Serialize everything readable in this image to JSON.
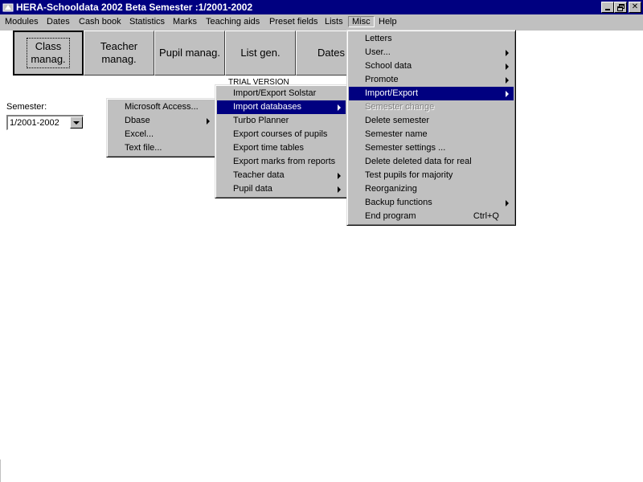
{
  "window": {
    "title": "HERA-Schooldata 2002 Beta Semester :1/2001-2002"
  },
  "menubar": [
    {
      "label": "Modules",
      "underline": "M"
    },
    {
      "label": "Dates",
      "underline": "D"
    },
    {
      "label": "Cash book",
      "underline": "C"
    },
    {
      "label": "Statistics",
      "underline": "S"
    },
    {
      "label": "Marks",
      "underline": "r"
    },
    {
      "label": "Teaching aids",
      "underline": "T"
    },
    {
      "label": "Preset fields",
      "underline": "P"
    },
    {
      "label": "Lists",
      "underline": "L"
    },
    {
      "label": "Misc",
      "underline": "i"
    },
    {
      "label": "Help",
      "underline": "H"
    }
  ],
  "toolbar": [
    {
      "label": "Class\nmanag."
    },
    {
      "label": "Teacher\nmanag."
    },
    {
      "label": "Pupil manag."
    },
    {
      "label": "List gen."
    },
    {
      "label": "Dates"
    }
  ],
  "semester": {
    "label": "Semester:",
    "value": "1/2001-2002"
  },
  "trial_text": "TRIAL VERSION",
  "misc_menu": [
    {
      "label": "Letters",
      "submenu": false
    },
    {
      "label": "User...",
      "submenu": true
    },
    {
      "label": "School data",
      "submenu": true
    },
    {
      "label": "Promote",
      "submenu": true
    },
    {
      "label": "Import/Export",
      "submenu": true,
      "highlighted": true
    },
    {
      "label": "Semester change",
      "disabled": true
    },
    {
      "label": "Delete semester"
    },
    {
      "label": "Semester name"
    },
    {
      "label": "Semester settings ..."
    },
    {
      "label": "Delete deleted data for real"
    },
    {
      "label": "Test pupils for majority"
    },
    {
      "label": "Reorganizing"
    },
    {
      "label": "Backup functions",
      "submenu": true
    },
    {
      "label": "End program",
      "shortcut": "Ctrl+Q"
    }
  ],
  "import_export_menu": [
    {
      "label": "Import/Export Solstar"
    },
    {
      "label": "Import databases",
      "submenu": true,
      "highlighted": true
    },
    {
      "label": "Turbo Planner"
    },
    {
      "label": "Export courses of pupils"
    },
    {
      "label": "Export time tables"
    },
    {
      "label": "Export marks from reports"
    },
    {
      "label": "Teacher data",
      "submenu": true
    },
    {
      "label": "Pupil data",
      "submenu": true
    }
  ],
  "import_databases_menu": [
    {
      "label": "Microsoft Access..."
    },
    {
      "label": "Dbase",
      "submenu": true
    },
    {
      "label": "Excel..."
    },
    {
      "label": "Text file..."
    }
  ]
}
